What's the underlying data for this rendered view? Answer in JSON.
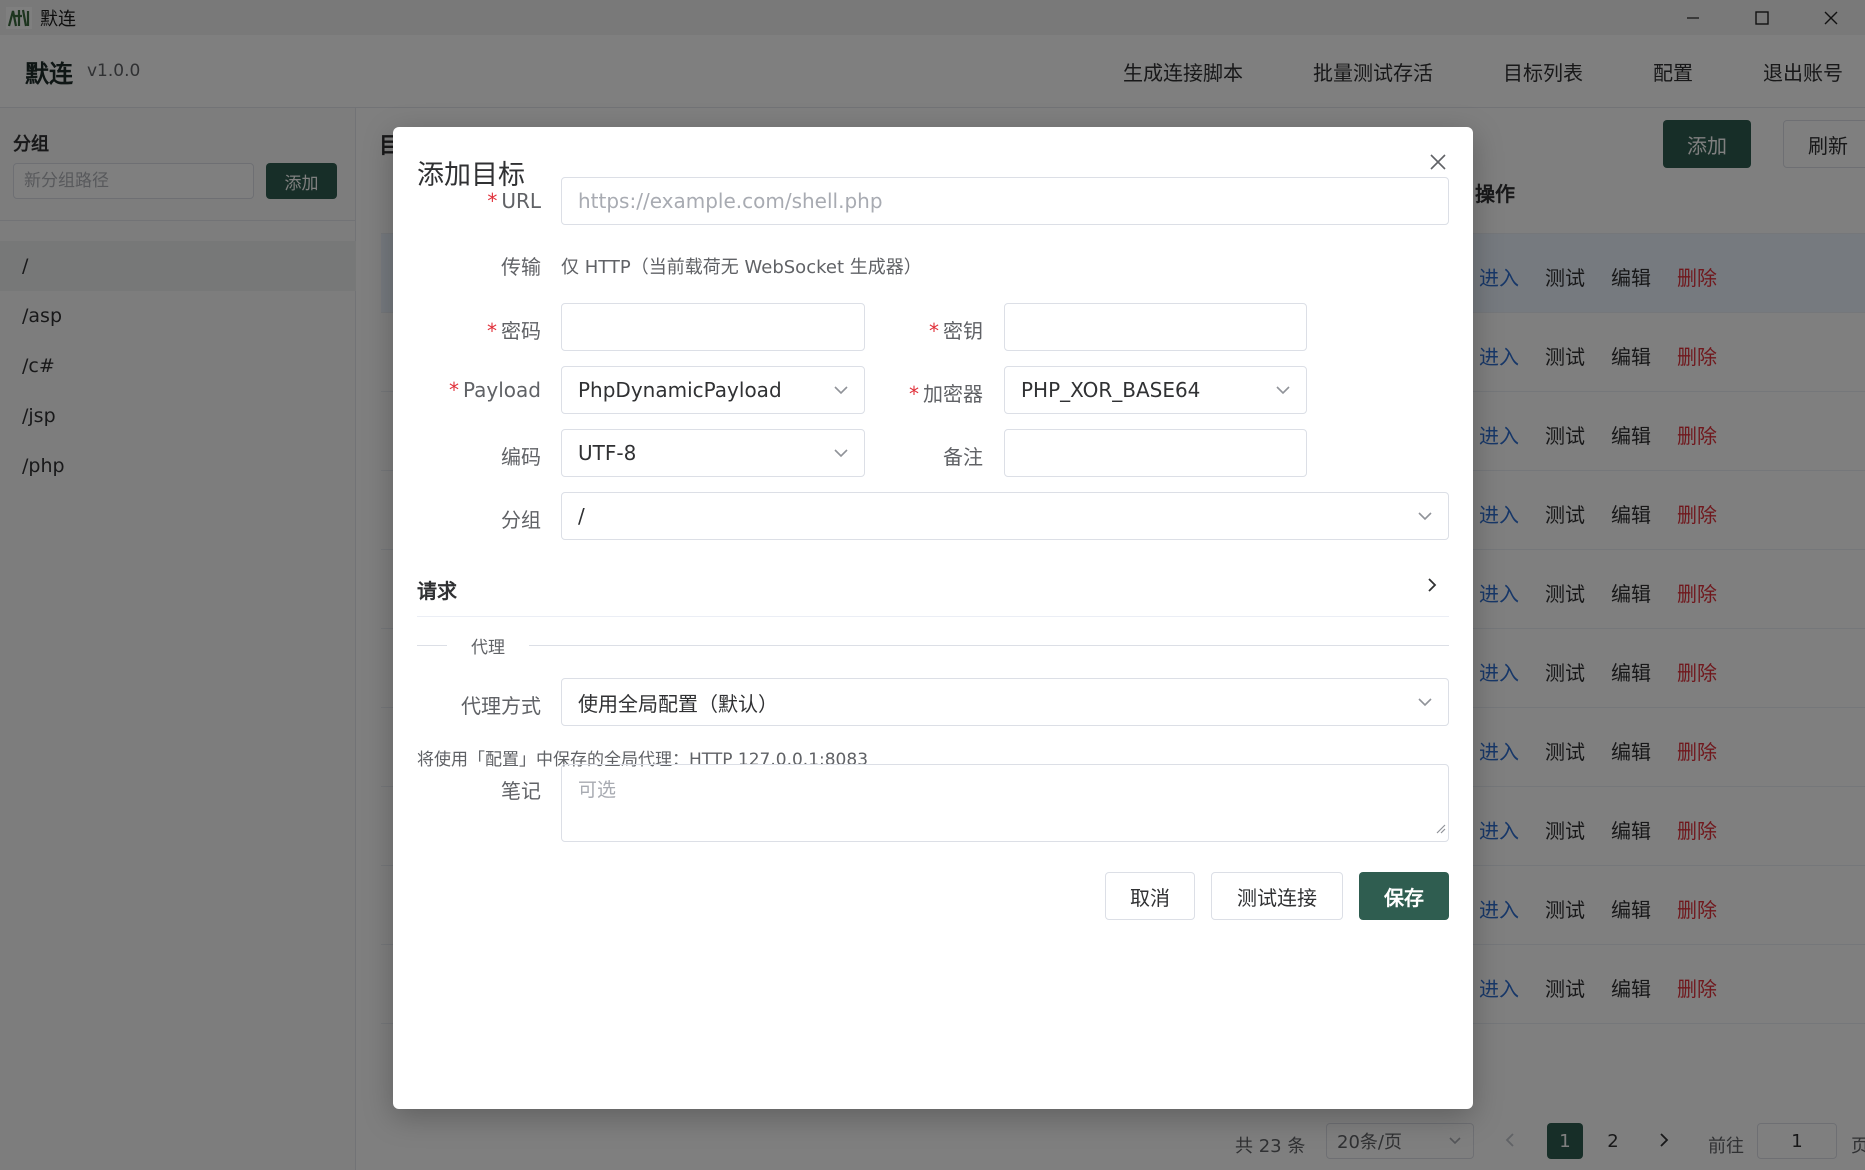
{
  "window": {
    "title": "默连",
    "icon": "app-logo-icon"
  },
  "header": {
    "brand": "默连",
    "version": "v1.0.0",
    "nav": [
      "生成连接脚本",
      "批量测试存活",
      "目标列表",
      "配置",
      "退出账号"
    ]
  },
  "sidebar": {
    "title": "分组",
    "new_group_placeholder": "新分组路径",
    "add_label": "添加",
    "groups": [
      "/",
      "/asp",
      "/c#",
      "/jsp",
      "/php"
    ],
    "active_group": "/"
  },
  "main": {
    "heading": "目",
    "add_label": "添加",
    "refresh_label": "刷新",
    "ops_header": "操作",
    "row_ops": {
      "enter": "进入",
      "test": "测试",
      "edit": "编辑",
      "delete": "删除"
    },
    "pagination": {
      "total": "共 23 条",
      "page_size": "20条/页",
      "pages": [
        "1",
        "2"
      ],
      "current_page": "1",
      "goto_label": "前往",
      "goto_value": "1",
      "page_suffix": "页"
    }
  },
  "modal": {
    "title": "添加目标",
    "url_label": "URL",
    "url_placeholder": "https://example.com/shell.php",
    "transport_label": "传输",
    "transport_value": "仅 HTTP（当前载荷无 WebSocket 生成器）",
    "password_label": "密码",
    "password_value": "",
    "key_label": "密钥",
    "key_value": "",
    "payload_label": "Payload",
    "payload_value": "PhpDynamicPayload",
    "encryptor_label": "加密器",
    "encryptor_value": "PHP_XOR_BASE64",
    "encoding_label": "编码",
    "encoding_value": "UTF-8",
    "remark_label": "备注",
    "remark_value": "",
    "group_label": "分组",
    "group_value": "/",
    "request_section": "请求",
    "proxy_divider": "代理",
    "proxy_mode_label": "代理方式",
    "proxy_mode_value": "使用全局配置（默认）",
    "proxy_hint": "将使用「配置」中保存的全局代理：HTTP 127.0.0.1:8083",
    "notes_label": "笔记",
    "notes_placeholder": "可选",
    "cancel_label": "取消",
    "test_label": "测试连接",
    "save_label": "保存"
  },
  "colors": {
    "primary": "#2f5d50",
    "link": "#2f6fd1",
    "danger": "#e0303a",
    "required": "#e0303a"
  }
}
